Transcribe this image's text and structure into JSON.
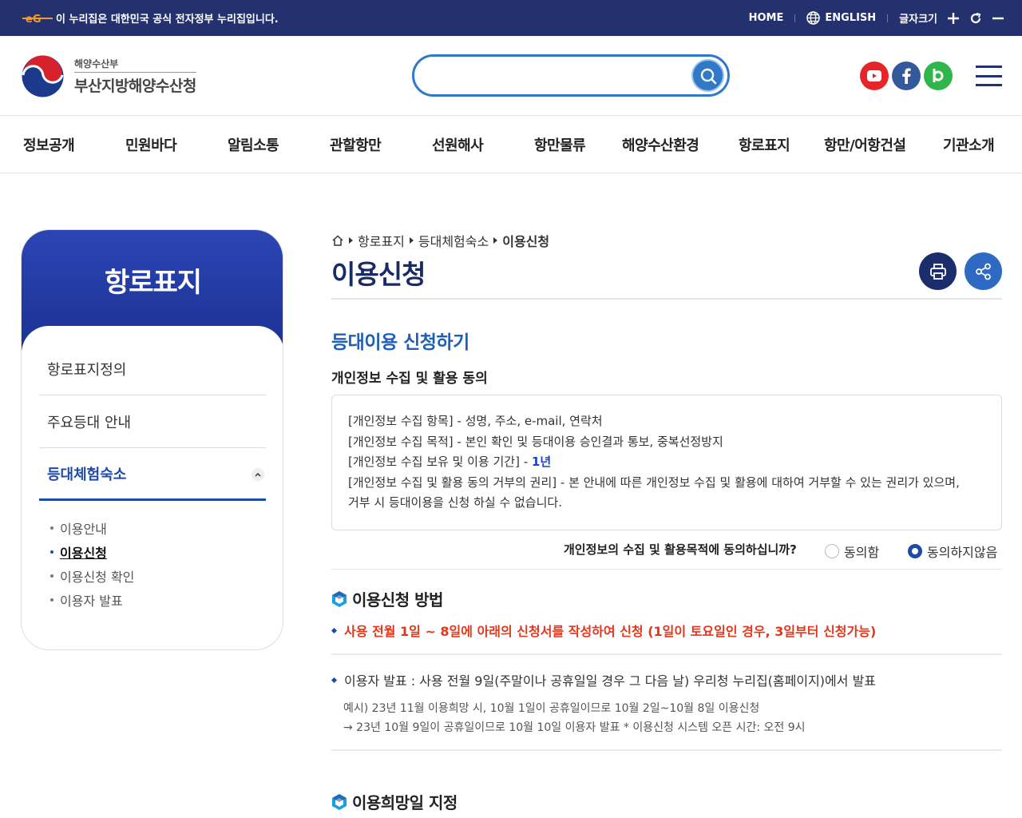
{
  "gov_bar": {
    "notice": "이 누리집은 대한민국 공식 전자정부 누리집입니다.",
    "home": "HOME",
    "english": "ENGLISH",
    "font_size": "글자크기"
  },
  "header": {
    "logo_sub": "해양수산부",
    "logo_main": "부산지방해양수산청",
    "search_placeholder": ""
  },
  "gnb": [
    "정보공개",
    "민원바다",
    "알림소통",
    "관할항만",
    "선원해사",
    "항만물류",
    "해양수산환경",
    "항로표지",
    "항만/어항건설",
    "기관소개"
  ],
  "lnb": {
    "title": "항로표지",
    "items": [
      "항로표지정의",
      "주요등대 안내",
      "등대체험숙소"
    ],
    "sub_items": [
      "이용안내",
      "이용신청",
      "이용신청 확인",
      "이용자 발표"
    ]
  },
  "breadcrumb": [
    "항로표지",
    "등대체험숙소",
    "이용신청"
  ],
  "page_title": "이용신청",
  "section": {
    "title": "등대이용 신청하기",
    "privacy_title": "개인정보 수집 및 활용 동의",
    "privacy_lines": [
      "[개인정보 수집 항목] - 성명, 주소, e-mail, 연락처",
      "[개인정보 수집 목적] - 본인 확인 및 등대이용 승인결과 통보, 중복선정방지",
      "[개인정보 수집 보유 및 이용 기간] - ",
      "[개인정보 수집 및 활용 동의 거부의 권리] - 본 안내에 따른 개인정보 수집 및 활용에 대하여 거부할 수 있는 권리가 있으며,",
      "거부 시 등대이용을 신청 하실 수 없습니다."
    ],
    "retention_period": "1년",
    "agree_question": "개인정보의 수집 및 활용목적에 동의하십니까?",
    "agree_yes": "동의함",
    "agree_no": "동의하지않음"
  },
  "method": {
    "title": "이용신청 방법",
    "notice": "사용 전월 1일 ~ 8일에 아래의 신청서를 작성하여 신청 (1일이 토요일인 경우, 3일부터 신청가능)",
    "announce": "이용자 발표 : 사용 전월 9일(주말이나 공휴일일 경우 그 다음 날) 우리청 누리집(홈페이지)에서 발표",
    "example1": "예시) 23년 11월 이용희망 시, 10월 1일이 공휴일이므로 10월 2일~10월 8일 이용신청",
    "example2": "→ 23년 10월 9일이 공휴일이므로 10월 10일 이용자 발표 * 이용신청 시스템 오픈 시간: 오전 9시"
  },
  "date_section": {
    "title": "이용희망일 지정"
  },
  "colors": {
    "gov_bar": "#23326e",
    "accent": "#1f4aa8",
    "search": "#2f79c8",
    "red": "#e2371c"
  }
}
